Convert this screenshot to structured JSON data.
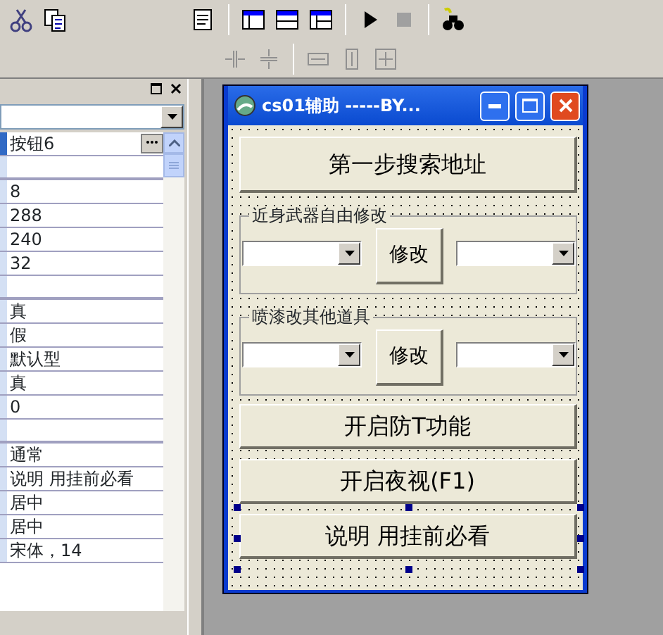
{
  "properties": {
    "rows": [
      {
        "kind": "value",
        "value": "按钮6",
        "selected": true
      },
      {
        "kind": "category",
        "selected": false
      },
      {
        "kind": "value",
        "value": "8",
        "selected": false
      },
      {
        "kind": "value",
        "value": "288",
        "selected": false
      },
      {
        "kind": "value",
        "value": "240",
        "selected": false
      },
      {
        "kind": "value",
        "value": "32",
        "selected": false
      },
      {
        "kind": "category",
        "selected": false
      },
      {
        "kind": "value",
        "value": "真",
        "selected": false
      },
      {
        "kind": "value",
        "value": "假",
        "selected": false
      },
      {
        "kind": "value",
        "value": "默认型",
        "selected": false
      },
      {
        "kind": "value",
        "value": "真",
        "selected": false
      },
      {
        "kind": "value",
        "value": "0",
        "selected": false
      },
      {
        "kind": "category",
        "selected": false
      },
      {
        "kind": "value",
        "value": "通常",
        "selected": false
      },
      {
        "kind": "value",
        "value": "说明 用挂前必看",
        "selected": false
      },
      {
        "kind": "value",
        "value": "居中",
        "selected": false
      },
      {
        "kind": "value",
        "value": "居中",
        "selected": false
      },
      {
        "kind": "value",
        "value": "宋体，14",
        "selected": false
      }
    ]
  },
  "form": {
    "title": "cs01辅助  -----BY...",
    "controls": [
      {
        "kind": "button",
        "label": "第一步搜索地址",
        "selected": false
      },
      {
        "kind": "group",
        "label": "近身武器自由修改",
        "button": "修改"
      },
      {
        "kind": "group",
        "label": "喷漆改其他道具",
        "button": "修改"
      },
      {
        "kind": "button",
        "label": "开启防T功能",
        "selected": false
      },
      {
        "kind": "button",
        "label": "开启夜视(F1)",
        "selected": false
      },
      {
        "kind": "button",
        "label": "说明  用挂前必看",
        "selected": true
      }
    ]
  }
}
